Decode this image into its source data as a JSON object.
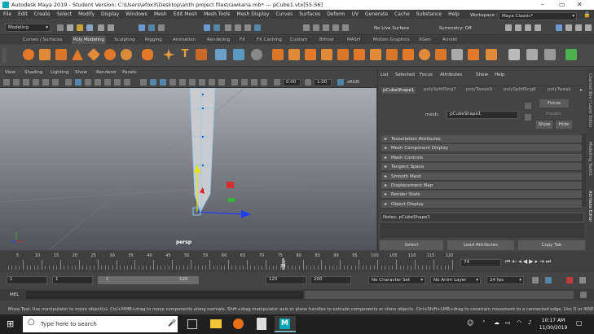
{
  "window": {
    "title": "Autodesk Maya 2019 - Student Version: C:\\Users\\efox3\\Desktop\\anth project files\\rawkana.mb*  ---  pCube1.vtx[55:56]"
  },
  "menu": [
    "File",
    "Edit",
    "Create",
    "Select",
    "Modify",
    "Display",
    "Windows",
    "Mesh",
    "Edit Mesh",
    "Mesh Tools",
    "Mesh Display",
    "Curves",
    "Surfaces",
    "Deform",
    "UV",
    "Generate",
    "Cache",
    "Substance",
    "Help"
  ],
  "status": {
    "mode": "Modeling",
    "live_surface": "No Live Surface",
    "symmetry": "Symmetry: Off",
    "workspace_label": "Workspace :",
    "workspace": "Maya Classic*"
  },
  "shelf_tabs": [
    "Curves / Surfaces",
    "Poly Modeling",
    "Sculpting",
    "Rigging",
    "Animation",
    "Rendering",
    "FX",
    "FX Caching",
    "Custom",
    "Bifrost",
    "MASH",
    "Motion Graphics",
    "XGen",
    "Arnold"
  ],
  "shelf_active": "Poly Modeling",
  "viewport": {
    "menu": [
      "View",
      "Shading",
      "Lighting",
      "Show",
      "Renderer",
      "Panels"
    ],
    "field1": "0.00",
    "field2": "1.00",
    "color_space": "sRGB",
    "camera": "persp"
  },
  "attribute_editor": {
    "menu": [
      "List",
      "Selected",
      "Focus",
      "Attributes",
      "Show",
      "Help"
    ],
    "tabs": [
      "pCubeShape1",
      "polySplitRing7",
      "polyTweak9",
      "polySplitRing6",
      "polyTweak"
    ],
    "active_tab": "pCubeShape1",
    "mesh_label": "mesh:",
    "mesh_value": "pCubeShape1",
    "focus": "Focus",
    "presets": "Presets",
    "show": "Show",
    "hide": "Hide",
    "sections": [
      "Tessellation Attributes",
      "Mesh Component Display",
      "Mesh Controls",
      "Tangent Space",
      "Smooth Mesh",
      "Displacement Map",
      "Render Stats",
      "Object Display"
    ],
    "notes": "Notes: pCubeShape1",
    "buttons": [
      "Select",
      "Load Attributes",
      "Copy Tab"
    ]
  },
  "side_tabs": [
    "Channel Box / Layer Editor",
    "Modelling Toolkit",
    "Attribute Editor"
  ],
  "timeline": {
    "ticks": [
      "5",
      "10",
      "15",
      "20",
      "25",
      "30",
      "35",
      "40",
      "45",
      "50",
      "55",
      "60",
      "65",
      "70",
      "75",
      "80",
      "85",
      "90",
      "95",
      "100",
      "105",
      "110",
      "115",
      "120"
    ],
    "current_frame": "74",
    "current_label": "74"
  },
  "range": {
    "start": "1",
    "start2": "1",
    "slider_start": "1",
    "slider_end": "120",
    "end": "120",
    "end2": "200",
    "character_set": "No Character Set",
    "anim_layer": "No Anim Layer",
    "fps": "24 fps"
  },
  "mel": {
    "label": "MEL"
  },
  "help_line": "Move Tool: Use manipulator to move object(s). Ctrl+MMB+drag to move components along normals. Shift+drag manipulator axis or plane handles to extrude components or clone objects. Ctrl+Shift+LMB+drag to constrain movement to a connected edge. Use D or INSERT to change",
  "taskbar": {
    "search": "Type here to search",
    "time": "10:17 AM",
    "date": "11/30/2019"
  },
  "colors": {
    "accent": "#5285a6",
    "active_shelf": "#555555"
  }
}
